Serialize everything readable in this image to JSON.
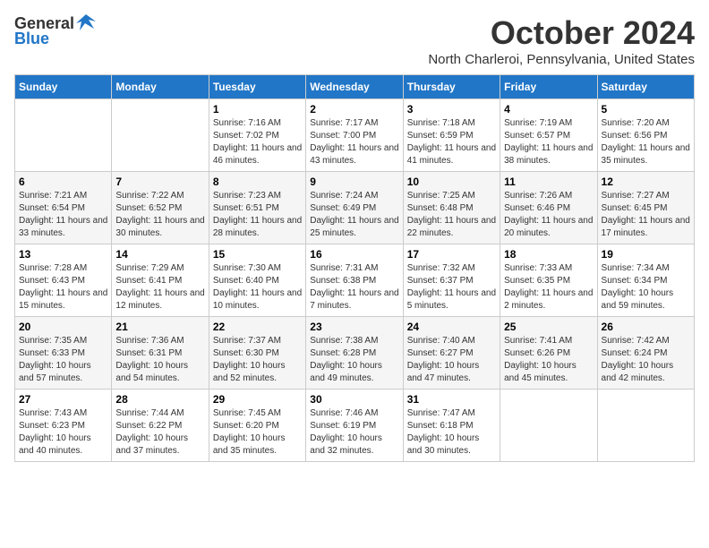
{
  "header": {
    "logo_general": "General",
    "logo_blue": "Blue",
    "month": "October 2024",
    "location": "North Charleroi, Pennsylvania, United States"
  },
  "days_of_week": [
    "Sunday",
    "Monday",
    "Tuesday",
    "Wednesday",
    "Thursday",
    "Friday",
    "Saturday"
  ],
  "weeks": [
    [
      {
        "day": "",
        "info": ""
      },
      {
        "day": "",
        "info": ""
      },
      {
        "day": "1",
        "sunrise": "Sunrise: 7:16 AM",
        "sunset": "Sunset: 7:02 PM",
        "daylight": "Daylight: 11 hours and 46 minutes."
      },
      {
        "day": "2",
        "sunrise": "Sunrise: 7:17 AM",
        "sunset": "Sunset: 7:00 PM",
        "daylight": "Daylight: 11 hours and 43 minutes."
      },
      {
        "day": "3",
        "sunrise": "Sunrise: 7:18 AM",
        "sunset": "Sunset: 6:59 PM",
        "daylight": "Daylight: 11 hours and 41 minutes."
      },
      {
        "day": "4",
        "sunrise": "Sunrise: 7:19 AM",
        "sunset": "Sunset: 6:57 PM",
        "daylight": "Daylight: 11 hours and 38 minutes."
      },
      {
        "day": "5",
        "sunrise": "Sunrise: 7:20 AM",
        "sunset": "Sunset: 6:56 PM",
        "daylight": "Daylight: 11 hours and 35 minutes."
      }
    ],
    [
      {
        "day": "6",
        "sunrise": "Sunrise: 7:21 AM",
        "sunset": "Sunset: 6:54 PM",
        "daylight": "Daylight: 11 hours and 33 minutes."
      },
      {
        "day": "7",
        "sunrise": "Sunrise: 7:22 AM",
        "sunset": "Sunset: 6:52 PM",
        "daylight": "Daylight: 11 hours and 30 minutes."
      },
      {
        "day": "8",
        "sunrise": "Sunrise: 7:23 AM",
        "sunset": "Sunset: 6:51 PM",
        "daylight": "Daylight: 11 hours and 28 minutes."
      },
      {
        "day": "9",
        "sunrise": "Sunrise: 7:24 AM",
        "sunset": "Sunset: 6:49 PM",
        "daylight": "Daylight: 11 hours and 25 minutes."
      },
      {
        "day": "10",
        "sunrise": "Sunrise: 7:25 AM",
        "sunset": "Sunset: 6:48 PM",
        "daylight": "Daylight: 11 hours and 22 minutes."
      },
      {
        "day": "11",
        "sunrise": "Sunrise: 7:26 AM",
        "sunset": "Sunset: 6:46 PM",
        "daylight": "Daylight: 11 hours and 20 minutes."
      },
      {
        "day": "12",
        "sunrise": "Sunrise: 7:27 AM",
        "sunset": "Sunset: 6:45 PM",
        "daylight": "Daylight: 11 hours and 17 minutes."
      }
    ],
    [
      {
        "day": "13",
        "sunrise": "Sunrise: 7:28 AM",
        "sunset": "Sunset: 6:43 PM",
        "daylight": "Daylight: 11 hours and 15 minutes."
      },
      {
        "day": "14",
        "sunrise": "Sunrise: 7:29 AM",
        "sunset": "Sunset: 6:41 PM",
        "daylight": "Daylight: 11 hours and 12 minutes."
      },
      {
        "day": "15",
        "sunrise": "Sunrise: 7:30 AM",
        "sunset": "Sunset: 6:40 PM",
        "daylight": "Daylight: 11 hours and 10 minutes."
      },
      {
        "day": "16",
        "sunrise": "Sunrise: 7:31 AM",
        "sunset": "Sunset: 6:38 PM",
        "daylight": "Daylight: 11 hours and 7 minutes."
      },
      {
        "day": "17",
        "sunrise": "Sunrise: 7:32 AM",
        "sunset": "Sunset: 6:37 PM",
        "daylight": "Daylight: 11 hours and 5 minutes."
      },
      {
        "day": "18",
        "sunrise": "Sunrise: 7:33 AM",
        "sunset": "Sunset: 6:35 PM",
        "daylight": "Daylight: 11 hours and 2 minutes."
      },
      {
        "day": "19",
        "sunrise": "Sunrise: 7:34 AM",
        "sunset": "Sunset: 6:34 PM",
        "daylight": "Daylight: 10 hours and 59 minutes."
      }
    ],
    [
      {
        "day": "20",
        "sunrise": "Sunrise: 7:35 AM",
        "sunset": "Sunset: 6:33 PM",
        "daylight": "Daylight: 10 hours and 57 minutes."
      },
      {
        "day": "21",
        "sunrise": "Sunrise: 7:36 AM",
        "sunset": "Sunset: 6:31 PM",
        "daylight": "Daylight: 10 hours and 54 minutes."
      },
      {
        "day": "22",
        "sunrise": "Sunrise: 7:37 AM",
        "sunset": "Sunset: 6:30 PM",
        "daylight": "Daylight: 10 hours and 52 minutes."
      },
      {
        "day": "23",
        "sunrise": "Sunrise: 7:38 AM",
        "sunset": "Sunset: 6:28 PM",
        "daylight": "Daylight: 10 hours and 49 minutes."
      },
      {
        "day": "24",
        "sunrise": "Sunrise: 7:40 AM",
        "sunset": "Sunset: 6:27 PM",
        "daylight": "Daylight: 10 hours and 47 minutes."
      },
      {
        "day": "25",
        "sunrise": "Sunrise: 7:41 AM",
        "sunset": "Sunset: 6:26 PM",
        "daylight": "Daylight: 10 hours and 45 minutes."
      },
      {
        "day": "26",
        "sunrise": "Sunrise: 7:42 AM",
        "sunset": "Sunset: 6:24 PM",
        "daylight": "Daylight: 10 hours and 42 minutes."
      }
    ],
    [
      {
        "day": "27",
        "sunrise": "Sunrise: 7:43 AM",
        "sunset": "Sunset: 6:23 PM",
        "daylight": "Daylight: 10 hours and 40 minutes."
      },
      {
        "day": "28",
        "sunrise": "Sunrise: 7:44 AM",
        "sunset": "Sunset: 6:22 PM",
        "daylight": "Daylight: 10 hours and 37 minutes."
      },
      {
        "day": "29",
        "sunrise": "Sunrise: 7:45 AM",
        "sunset": "Sunset: 6:20 PM",
        "daylight": "Daylight: 10 hours and 35 minutes."
      },
      {
        "day": "30",
        "sunrise": "Sunrise: 7:46 AM",
        "sunset": "Sunset: 6:19 PM",
        "daylight": "Daylight: 10 hours and 32 minutes."
      },
      {
        "day": "31",
        "sunrise": "Sunrise: 7:47 AM",
        "sunset": "Sunset: 6:18 PM",
        "daylight": "Daylight: 10 hours and 30 minutes."
      },
      {
        "day": "",
        "info": ""
      },
      {
        "day": "",
        "info": ""
      }
    ]
  ]
}
